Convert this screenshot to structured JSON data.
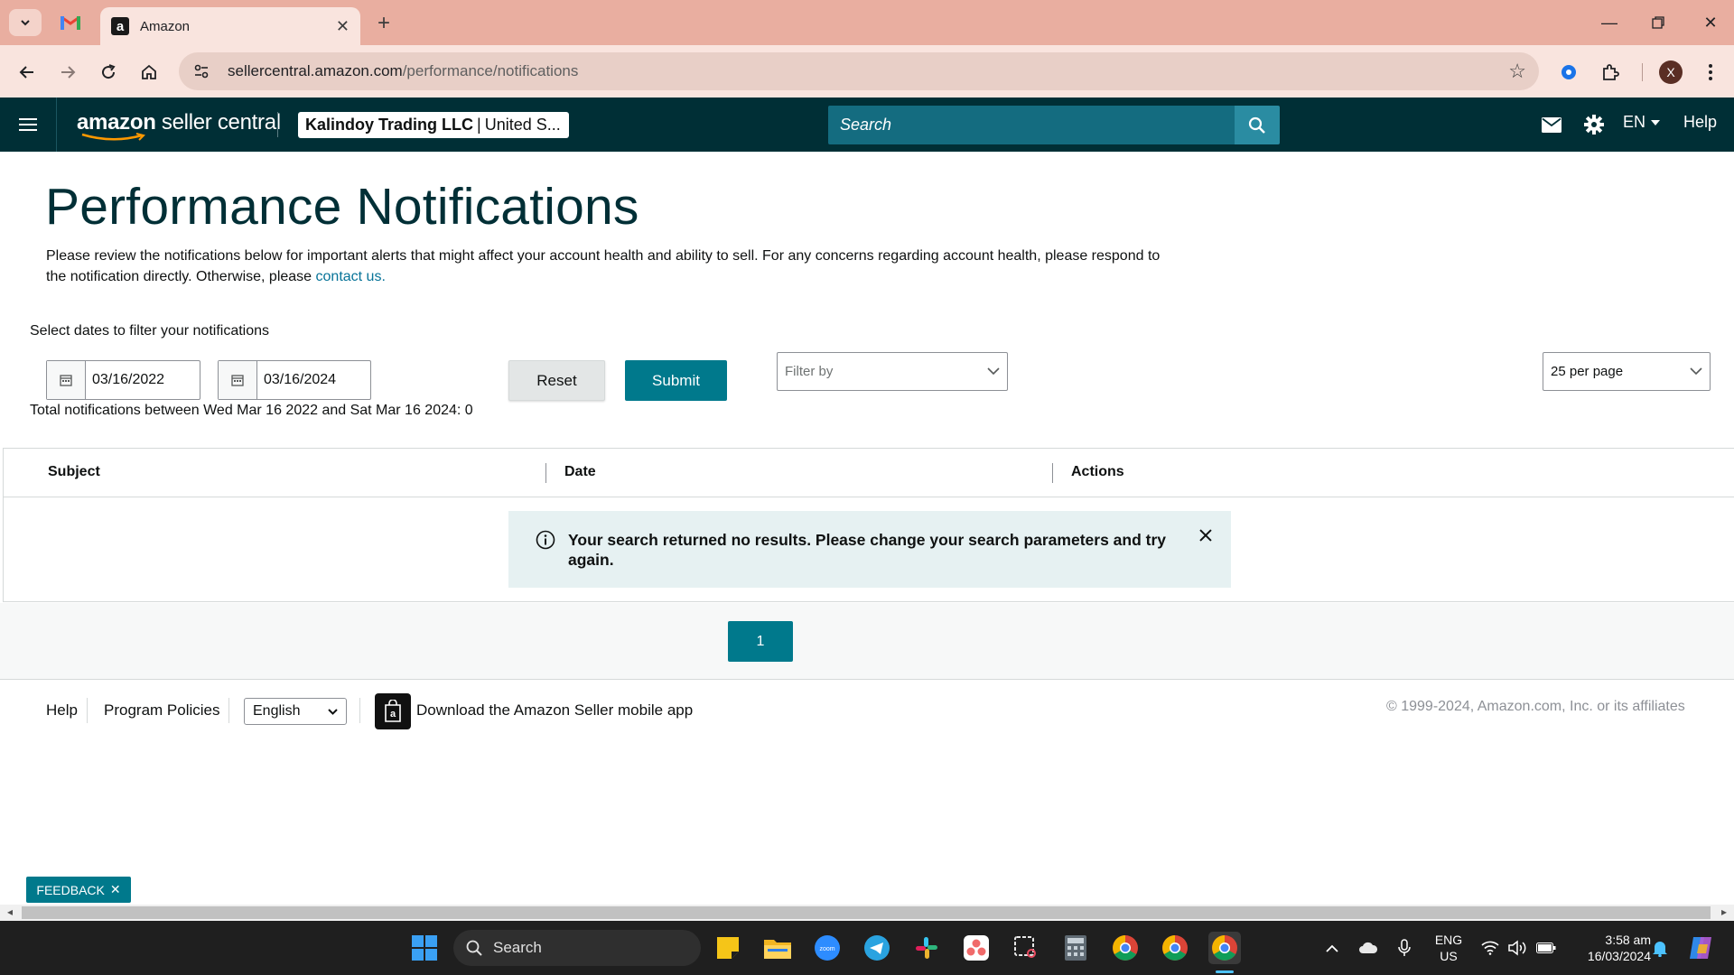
{
  "browser": {
    "tab_title": "Amazon",
    "url_host": "sellercentral.amazon.com",
    "url_path": "/performance/notifications",
    "profile_initial": "X"
  },
  "header": {
    "logo_bold": "amazon",
    "logo_rest": " seller central",
    "account_name": "Kalindoy Trading LLC",
    "account_sep": "|",
    "account_region": "United S...",
    "search_placeholder": "Search",
    "language": "EN",
    "help": "Help"
  },
  "page": {
    "title": "Performance Notifications",
    "intro": "Please review the notifications below for important alerts that might affect your account health and ability to sell. For any concerns regarding account health, please respond to the notification directly. Otherwise, please ",
    "intro_link": "contact us.",
    "filter_label": "Select dates to filter your notifications",
    "start_date": "03/16/2022",
    "end_date": "03/16/2024",
    "reset_label": "Reset",
    "submit_label": "Submit",
    "filter_placeholder": "Filter by",
    "per_page": "25 per page",
    "total_text": "Total notifications between Wed Mar 16 2022 and Sat Mar 16 2024: 0"
  },
  "table": {
    "columns": [
      "Subject",
      "Date",
      "Actions"
    ],
    "empty_message": "Your search returned no results. Please change your search parameters and try again."
  },
  "pagination": {
    "current_page": "1"
  },
  "footer": {
    "help": "Help",
    "program_policies": "Program Policies",
    "language": "English",
    "app_download": "Download the Amazon Seller mobile app",
    "copyright": "© 1999-2024, Amazon.com, Inc. or its affiliates"
  },
  "feedback_label": "FEEDBACK",
  "taskbar": {
    "search_label": "Search",
    "lang_line1": "ENG",
    "lang_line2": "US",
    "time": "3:58 am",
    "date": "16/03/2024"
  },
  "colors": {
    "tabstrip": "#e9aea0",
    "toolbar": "#f9e4de",
    "amazon_header": "#002f36",
    "accent_teal": "#00798c",
    "link": "#077398"
  }
}
